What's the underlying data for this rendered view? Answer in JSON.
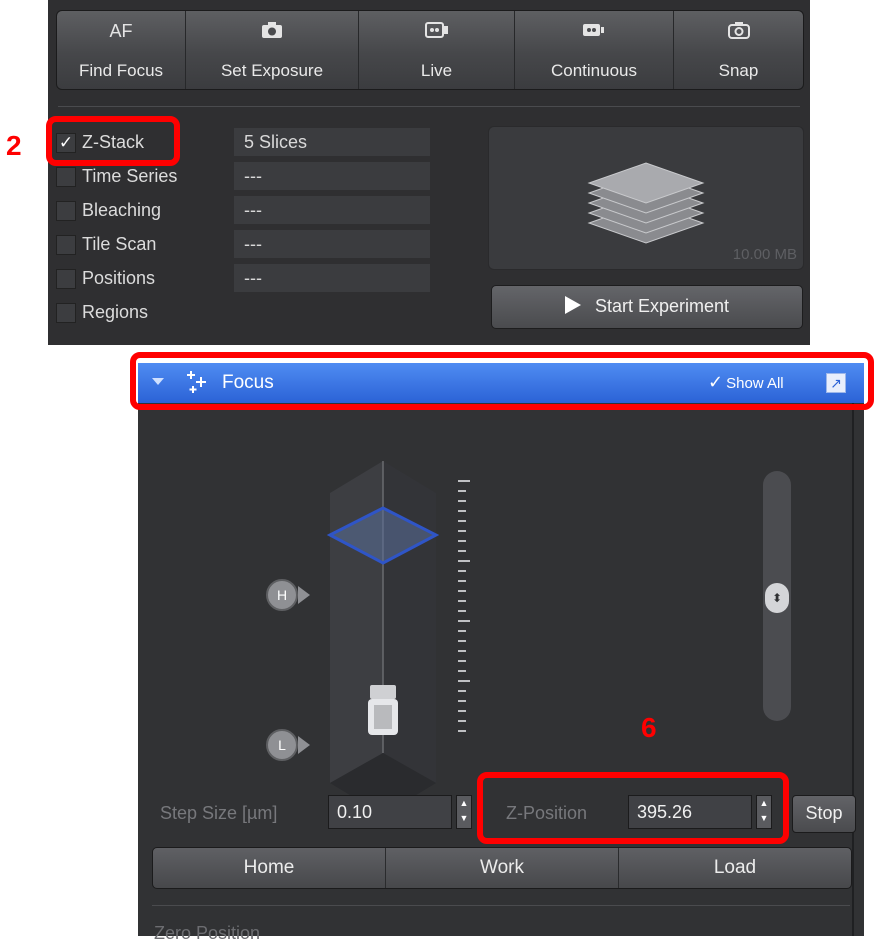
{
  "toolbar": {
    "buttons": [
      {
        "icon_text": "AF",
        "label": "Find Focus",
        "icon": "af-text-icon"
      },
      {
        "icon_text": "",
        "label": "Set Exposure",
        "icon": "camera-icon"
      },
      {
        "icon_text": "",
        "label": "Live",
        "icon": "video-camera-icon"
      },
      {
        "icon_text": "",
        "label": "Continuous",
        "icon": "video-camera-icon"
      },
      {
        "icon_text": "",
        "label": "Snap",
        "icon": "photo-camera-icon"
      }
    ]
  },
  "experiment": {
    "rows": [
      {
        "label": "Z-Stack",
        "checked": true,
        "value": "5 Slices"
      },
      {
        "label": "Time Series",
        "checked": false,
        "value": "---"
      },
      {
        "label": "Bleaching",
        "checked": false,
        "value": "---"
      },
      {
        "label": "Tile Scan",
        "checked": false,
        "value": "---"
      },
      {
        "label": "Positions",
        "checked": false,
        "value": "---"
      },
      {
        "label": "Regions",
        "checked": false
      }
    ],
    "checkmark": "✓",
    "preview_size": "10.00 MB",
    "start_label": "Start Experiment"
  },
  "focus": {
    "title": "Focus",
    "show_all": "Show All",
    "check": "✓",
    "h_label": "H",
    "l_label": "L",
    "step_size_label": "Step Size [µm]",
    "step_size_value": "0.10",
    "z_position_label": "Z-Position",
    "z_position_value": "395.26",
    "stop_label": "Stop",
    "positions": [
      "Home",
      "Work",
      "Load"
    ],
    "next_section": "Zero Position"
  },
  "annotations": {
    "label_2": "2",
    "label_6": "6"
  },
  "colors": {
    "annotation": "#ff0000",
    "header_blue": "#2b62d6",
    "panel_bg": "#2f2f31"
  }
}
